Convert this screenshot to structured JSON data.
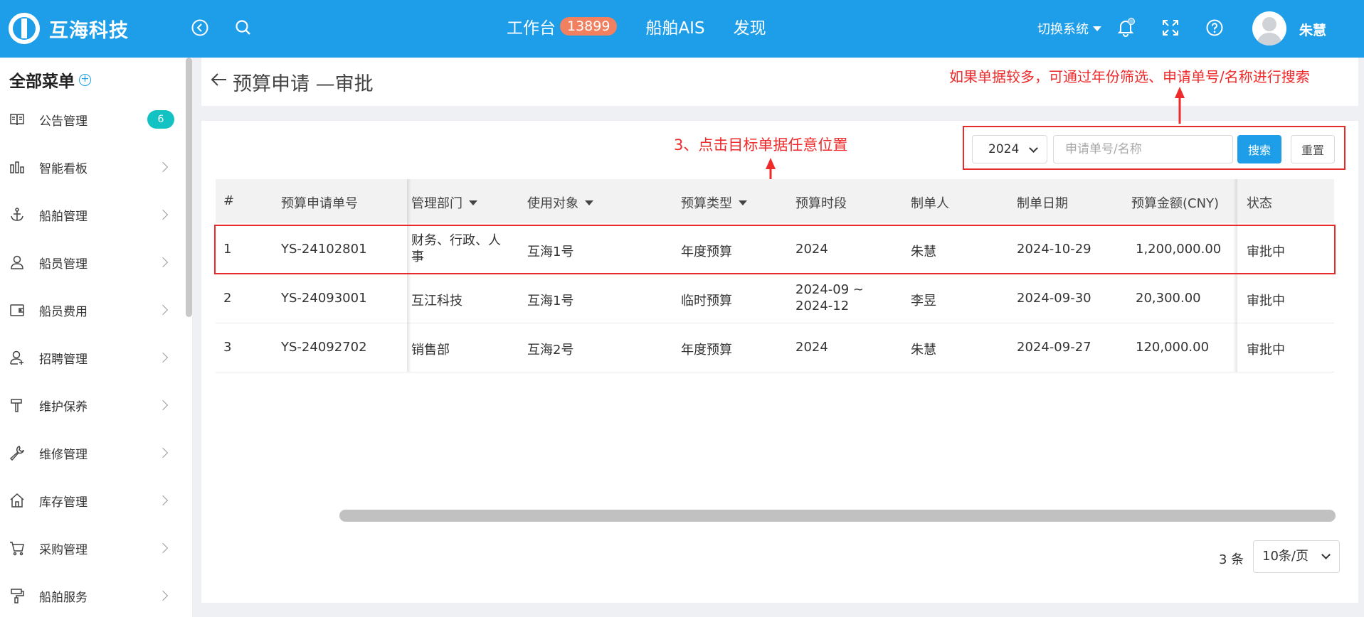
{
  "header": {
    "brand": "互海科技",
    "nav": [
      {
        "label": "工作台",
        "badge": "13899"
      },
      {
        "label": "船舶AIS"
      },
      {
        "label": "发现"
      }
    ],
    "switch_system": "切换系统",
    "user_name": "朱慧",
    "accent": "#1e9ee8"
  },
  "sidebar": {
    "title": "全部菜单",
    "items": [
      {
        "label": "公告管理",
        "icon": "book-icon",
        "badge": "6"
      },
      {
        "label": "智能看板",
        "icon": "bar-chart-icon"
      },
      {
        "label": "船舶管理",
        "icon": "anchor-icon"
      },
      {
        "label": "船员管理",
        "icon": "user-icon"
      },
      {
        "label": "船员费用",
        "icon": "wallet-icon"
      },
      {
        "label": "招聘管理",
        "icon": "user-add-icon"
      },
      {
        "label": "维护保养",
        "icon": "hammer-icon"
      },
      {
        "label": "维修管理",
        "icon": "wrench-icon"
      },
      {
        "label": "库存管理",
        "icon": "home-icon"
      },
      {
        "label": "采购管理",
        "icon": "cart-icon"
      },
      {
        "label": "船舶服务",
        "icon": "paint-roller-icon"
      }
    ]
  },
  "page": {
    "title": "预算申请 —审批"
  },
  "annotations": {
    "search_hint": "如果单据较多，可通过年份筛选、申请单号/名称进行搜索",
    "click_hint": "3、点击目标单据任意位置",
    "highlight_color": "#e62b2b"
  },
  "filters": {
    "year": "2024",
    "search_placeholder": "申请单号/名称",
    "search_button": "搜索",
    "reset_button": "重置"
  },
  "table": {
    "columns": [
      "#",
      "预算申请单号",
      "管理部门",
      "使用对象",
      "预算类型",
      "预算时段",
      "制单人",
      "制单日期",
      "预算金额(CNY)",
      "状态"
    ],
    "rows": [
      {
        "no": "1",
        "code": "YS-24102801",
        "dept": "财务、行政、人事",
        "target": "互海1号",
        "type": "年度预算",
        "period": "2024",
        "creator": "朱慧",
        "date": "2024-10-29",
        "amount": "1,200,000.00",
        "status": "审批中"
      },
      {
        "no": "2",
        "code": "YS-24093001",
        "dept": "互江科技",
        "target": "互海1号",
        "type": "临时预算",
        "period": "2024-09 ~ 2024-12",
        "creator": "李昱",
        "date": "2024-09-30",
        "amount": "20,300.00",
        "status": "审批中"
      },
      {
        "no": "3",
        "code": "YS-24092702",
        "dept": "销售部",
        "target": "互海2号",
        "type": "年度预算",
        "period": "2024",
        "creator": "朱慧",
        "date": "2024-09-27",
        "amount": "120,000.00",
        "status": "审批中"
      }
    ]
  },
  "pagination": {
    "total": "3 条",
    "page_size": "10条/页"
  }
}
